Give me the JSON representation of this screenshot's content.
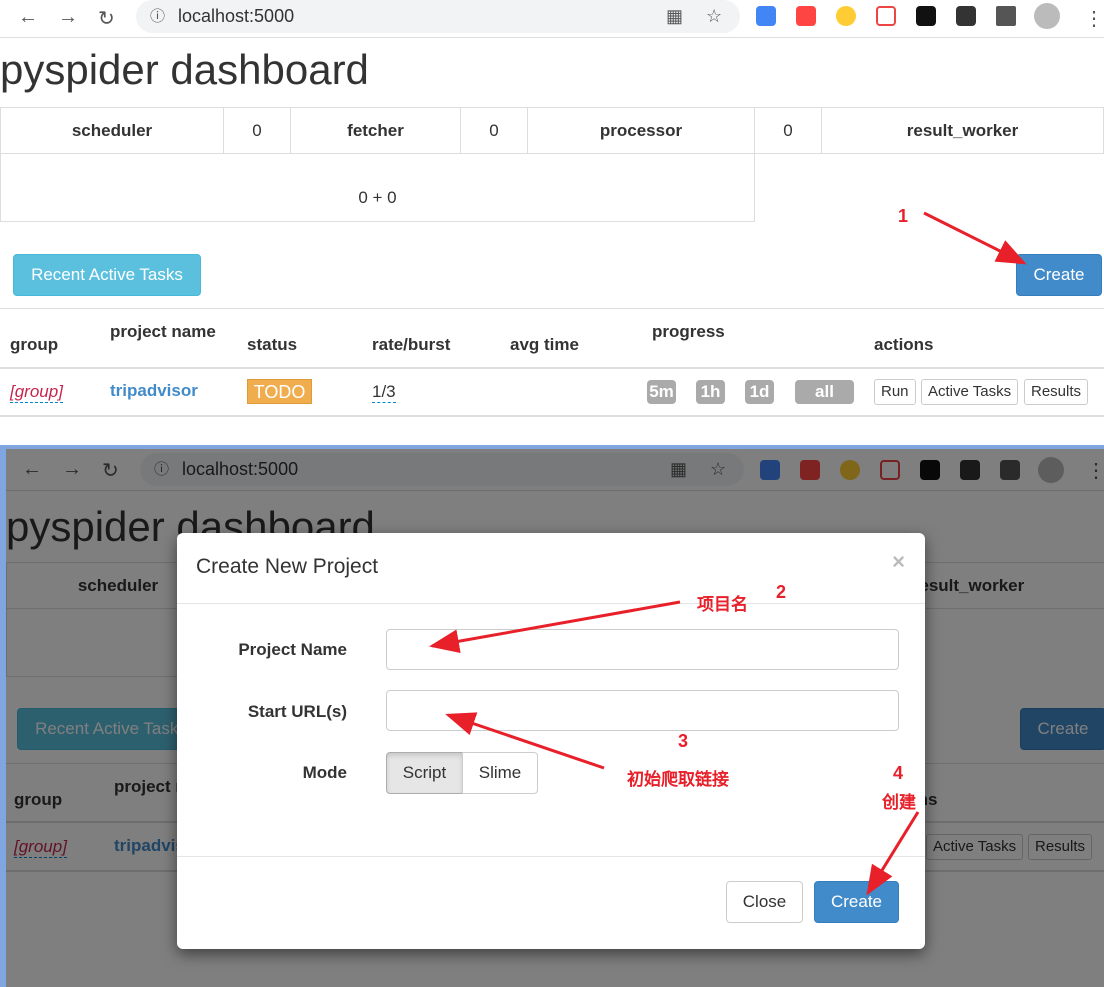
{
  "browser": {
    "url": "localhost:5000"
  },
  "page": {
    "title": "pyspider dashboard"
  },
  "stats": {
    "scheduler": "scheduler",
    "scheduler_count": "0",
    "fetcher": "fetcher",
    "fetcher_count": "0",
    "processor": "processor",
    "processor_count": "0",
    "result_worker": "result_worker",
    "queue_total": "0 + 0"
  },
  "buttons": {
    "recent": "Recent Active Tasks",
    "create": "Create"
  },
  "table": {
    "headers": [
      "group",
      "project name",
      "status",
      "rate/burst",
      "avg time",
      "progress",
      "actions"
    ],
    "row": {
      "group": "[group]",
      "name": "tripadvisor",
      "status": "TODO",
      "rate": "1/3",
      "progress": [
        "5m",
        "1h",
        "1d",
        "all"
      ],
      "actions": [
        "Run",
        "Active Tasks",
        "Results"
      ]
    }
  },
  "colors": {
    "primary": "#428bca",
    "info": "#5bc0de",
    "warning": "#f0ad4e",
    "annotation": "#e8202a"
  },
  "modal": {
    "title": "Create New Project",
    "close_x": "×",
    "project_name_label": "Project Name",
    "start_urls_label": "Start URL(s)",
    "mode_label": "Mode",
    "mode_options": [
      "Script",
      "Slime"
    ],
    "mode_selected": "Script",
    "close": "Close",
    "create": "Create"
  },
  "annotations": {
    "a1": "1",
    "a2": "2",
    "a2_text": "项目名",
    "a3": "3",
    "a3_text": "初始爬取链接",
    "a4": "4",
    "a4_text": "创建"
  }
}
